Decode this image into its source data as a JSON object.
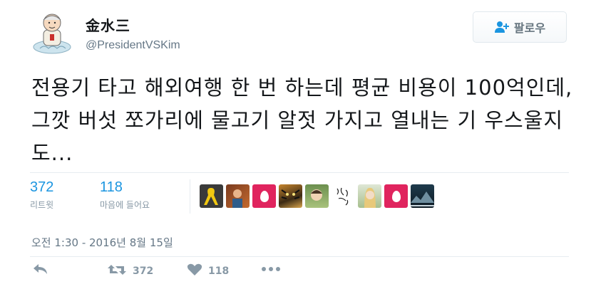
{
  "header": {
    "display_name": "金水三",
    "handle": "@PresidentVSKim",
    "follow_label": "팔로우"
  },
  "tweet": {
    "text": "전용기 타고 해외여행 한 번 하는데 평균 비용이 100억인데, 그깟 버섯 쪼가리에 물고기 알젓 가지고 열내는 기 우스울지도..."
  },
  "stats": {
    "retweets_value": "372",
    "retweets_label": "리트윗",
    "likes_value": "118",
    "likes_label": "마음에 들어요"
  },
  "likers": [
    {
      "kind": "yellow-ribbon"
    },
    {
      "kind": "photo-person"
    },
    {
      "kind": "default-egg"
    },
    {
      "kind": "tiger-photo"
    },
    {
      "kind": "child-photo"
    },
    {
      "kind": "calligraphy"
    },
    {
      "kind": "portrait-photo"
    },
    {
      "kind": "default-egg"
    },
    {
      "kind": "landscape-photo"
    }
  ],
  "timestamp": "오전 1:30 - 2016년 8월 15일",
  "actions": {
    "retweet_count": "372",
    "like_count": "118"
  },
  "colors": {
    "link_blue": "#1b95e0",
    "muted_gray": "#8899a6",
    "egg_pink": "#e0245e"
  }
}
